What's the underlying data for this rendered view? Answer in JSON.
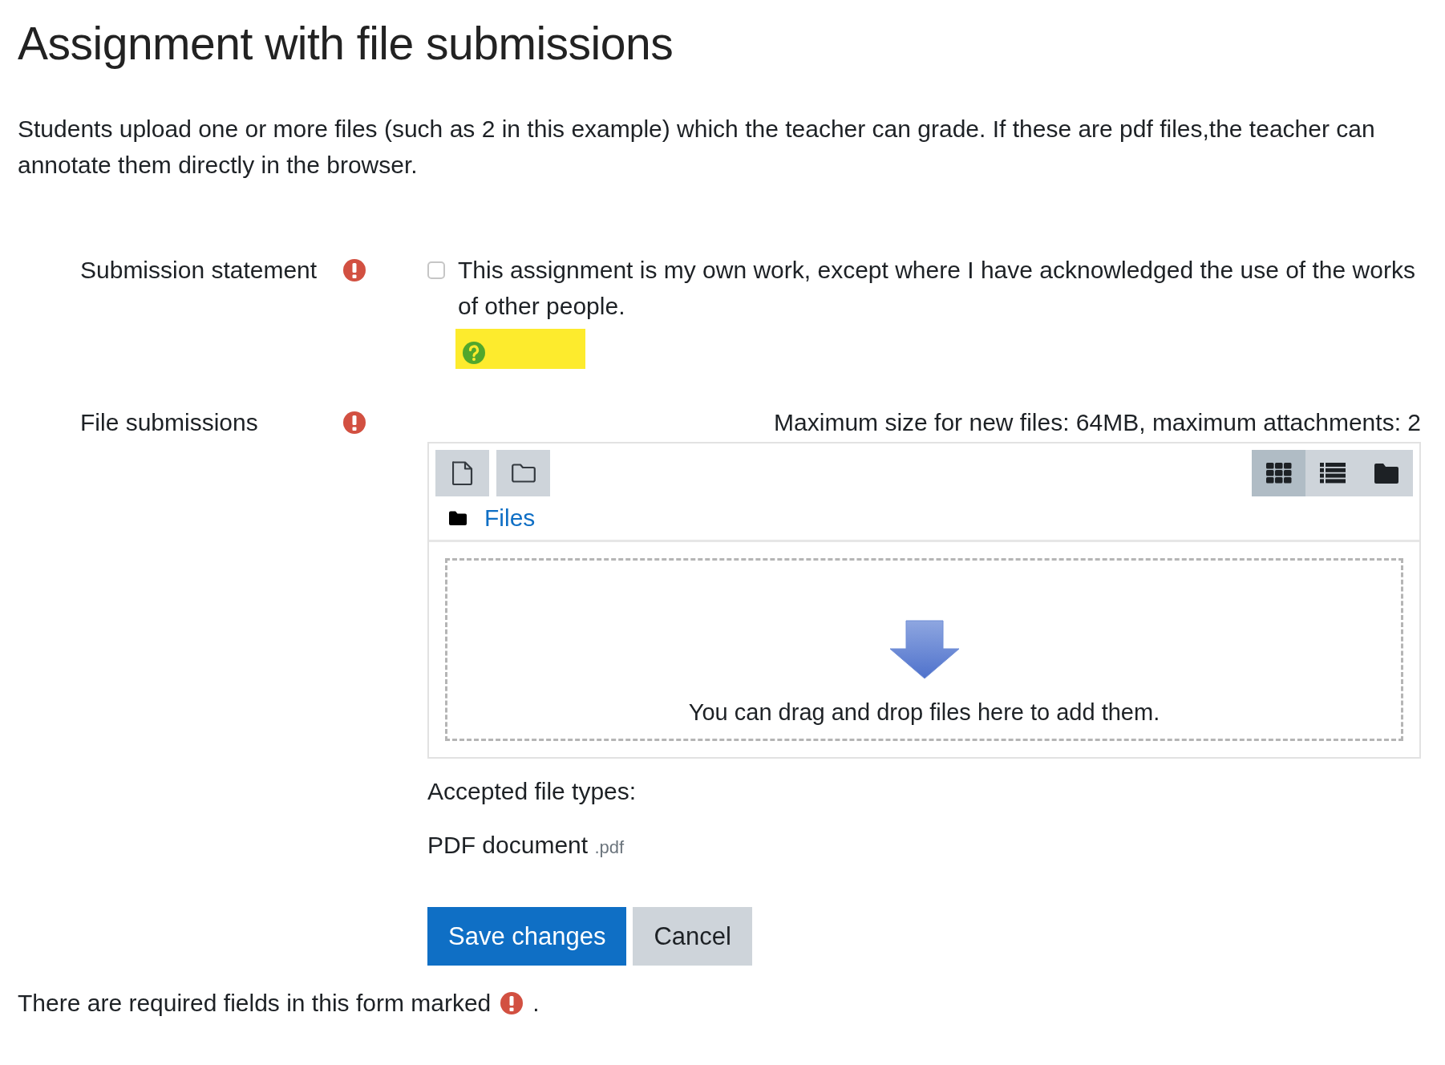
{
  "page": {
    "title": "Assignment with file submissions",
    "intro": "Students upload one or more files (such as 2 in this example) which the teacher can grade. If these are pdf files,the teacher can annotate them directly in the browser."
  },
  "statement": {
    "label": "Submission statement",
    "required": true,
    "checkbox": {
      "checked": false,
      "label": "This assignment is my own work, except where I have acknowledged the use of the works of other people."
    }
  },
  "files": {
    "label": "File submissions",
    "required": true,
    "limits": "Maximum size for new files: 64MB, maximum attachments: 2",
    "view_modes": [
      {
        "kind": "icons",
        "selected": true
      },
      {
        "kind": "list",
        "selected": false
      },
      {
        "kind": "tree",
        "selected": false
      }
    ],
    "breadcrumb": "Files",
    "dropzone": "You can drag and drop files here to add them.",
    "accepted_label": "Accepted file types:",
    "file_types": [
      {
        "name": "PDF document",
        "extension": ".pdf"
      }
    ]
  },
  "buttons": [
    {
      "kind": "primary",
      "label": "Save changes"
    },
    {
      "kind": "secondary",
      "label": "Cancel"
    }
  ],
  "footer": {
    "text": "There are required fields in this form marked",
    "suffix": "."
  }
}
